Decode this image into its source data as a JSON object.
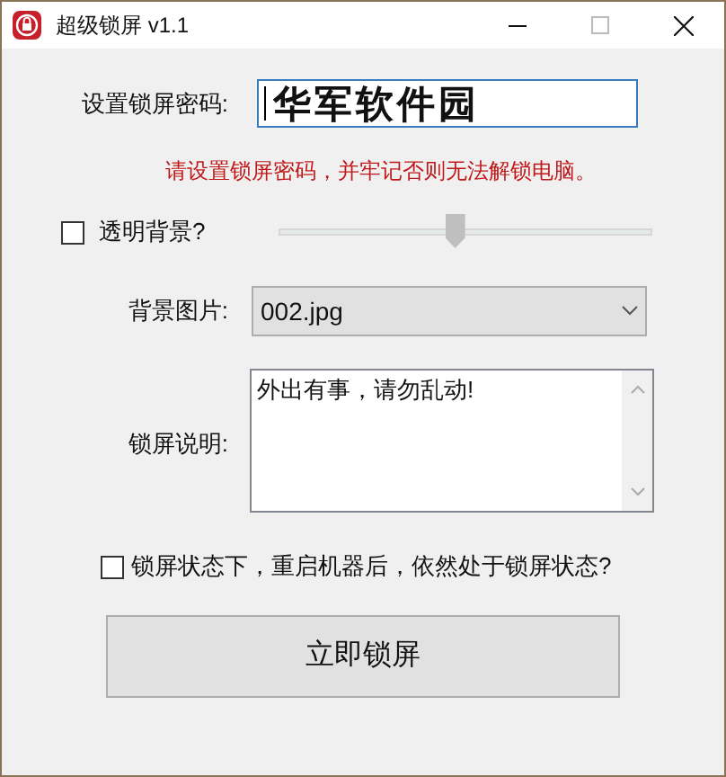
{
  "window": {
    "title": "超级锁屏 v1.1"
  },
  "password": {
    "label": "设置锁屏密码:",
    "value": "华军软件园"
  },
  "hint": "请设置锁屏密码，并牢记否则无法解锁电脑。",
  "transparent": {
    "label": "透明背景?",
    "checked": false,
    "level": 0.47
  },
  "background": {
    "label": "背景图片:",
    "value": "002.jpg"
  },
  "note": {
    "label": "锁屏说明:",
    "value": "外出有事，请勿乱动!"
  },
  "persist": {
    "label": "锁屏状态下，重启机器后，依然处于锁屏状态?",
    "checked": false
  },
  "lock_button": "立即锁屏"
}
